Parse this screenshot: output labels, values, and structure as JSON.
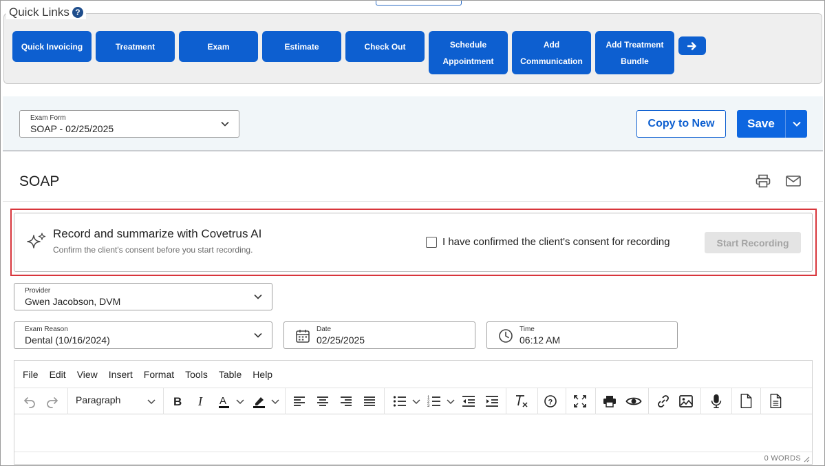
{
  "quick_links": {
    "title": "Quick Links",
    "help": "?",
    "buttons": [
      {
        "label": "Quick Invoicing"
      },
      {
        "label": "Treatment"
      },
      {
        "label": "Exam"
      },
      {
        "label": "Estimate"
      },
      {
        "label": "Check Out"
      },
      {
        "label": "Schedule Appointment"
      },
      {
        "label": "Add Communication"
      },
      {
        "label": "Add Treatment Bundle"
      }
    ]
  },
  "exam_form": {
    "label": "Exam Form",
    "value": "SOAP - 02/25/2025",
    "copy_label": "Copy to New",
    "save_label": "Save"
  },
  "soap": {
    "title": "SOAP"
  },
  "ai": {
    "title": "Record and summarize with Covetrus AI",
    "subtitle": "Confirm the client's consent before you start recording.",
    "consent_label": "I have confirmed the client's consent for recording",
    "consent_checked": false,
    "start_label": "Start Recording"
  },
  "fields": {
    "provider_label": "Provider",
    "provider_value": "Gwen Jacobson, DVM",
    "reason_label": "Exam Reason",
    "reason_value": "Dental (10/16/2024)",
    "date_label": "Date",
    "date_value": "02/25/2025",
    "time_label": "Time",
    "time_value": "06:12 AM"
  },
  "editor": {
    "menu": [
      "File",
      "Edit",
      "View",
      "Insert",
      "Format",
      "Tools",
      "Table",
      "Help"
    ],
    "block_format": "Paragraph",
    "word_count": "0 WORDS"
  },
  "colors": {
    "primary": "#0d5fd0",
    "highlight_outline": "#d8353b",
    "disabled": "#e4e4e4"
  }
}
